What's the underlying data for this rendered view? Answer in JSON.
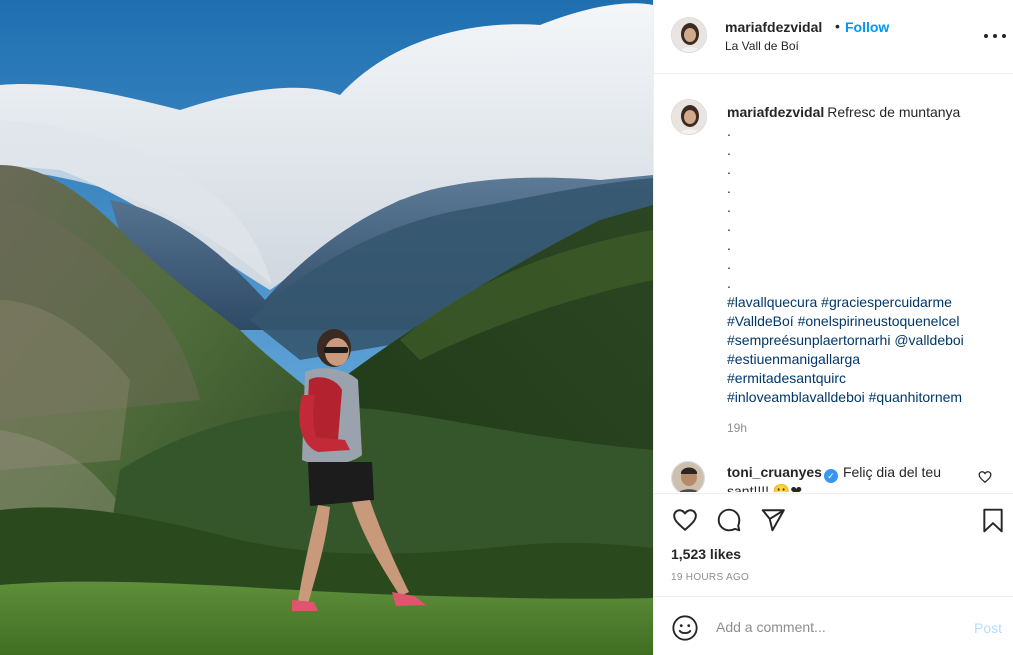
{
  "post": {
    "username": "mariafdezvidal",
    "separator": "•",
    "follow_label": "Follow",
    "location": "La Vall de Boí",
    "caption_text": "Refresc de muntanya",
    "caption_dots": [
      ".",
      ".",
      ".",
      ".",
      ".",
      ".",
      ".",
      ".",
      "."
    ],
    "hashtag_lines": [
      "#lavallquecura #graciespercuidarme",
      "#ValldeBoí #onelspirineustoquenelcel",
      "#sempreésunplaertornarhi @valldeboi",
      "#estiuenmanigallarga",
      "#ermitadesantquirc",
      "#inloveamblavalldeboi #quanhitornem"
    ],
    "time_ago": "19h",
    "likes": "1,523 likes",
    "timestamp": "19 HOURS AGO"
  },
  "comment": {
    "username": "toni_cruanyes",
    "verified_symbol": "✓",
    "text": "Feliç dia del teu",
    "line2": "sant!!!! 🙂❤"
  },
  "composer": {
    "placeholder": "Add a comment...",
    "post_label": "Post"
  },
  "icons": {
    "avatar": "profile-avatar",
    "more": "more-options-icon",
    "heart": "heart-icon",
    "comment": "comment-icon",
    "share": "share-icon",
    "save": "bookmark-icon",
    "emoji": "emoji-icon",
    "verified": "verified-badge-icon"
  },
  "colors": {
    "link_blue": "#0095f6",
    "hashtag": "#00376b",
    "muted": "#8e8e8e",
    "post_disabled": "#b2dffc",
    "verified": "#3897f0"
  }
}
